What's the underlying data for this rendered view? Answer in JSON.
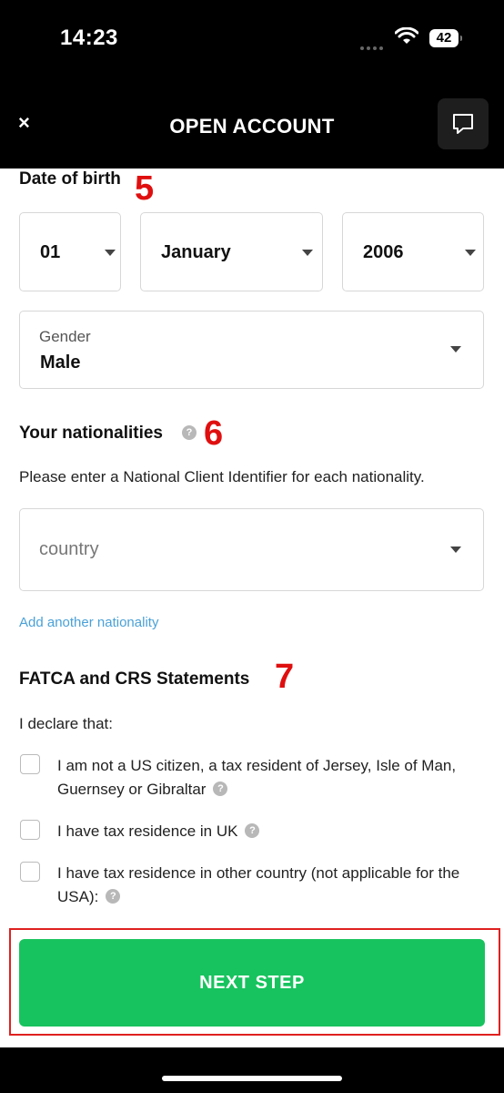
{
  "status_bar": {
    "time": "14:23",
    "battery": "42"
  },
  "header": {
    "close_label": "×",
    "title": "OPEN ACCOUNT"
  },
  "dob": {
    "title": "Date of birth",
    "step": "5",
    "day": "01",
    "month": "January",
    "year": "2006"
  },
  "gender": {
    "label": "Gender",
    "value": "Male"
  },
  "nationalities": {
    "title": "Your nationalities",
    "step": "6",
    "description": "Please enter a National Client Identifier for each nationality.",
    "country_placeholder": "country",
    "add_link": "Add another nationality"
  },
  "fatca": {
    "title": "FATCA and CRS Statements",
    "step": "7",
    "intro": "I declare that:",
    "items": [
      {
        "label": "I am not a US citizen, a tax resident of Jersey, Isle of Man, Guernsey or Gibraltar",
        "checked": false
      },
      {
        "label": "I have tax residence in UK",
        "checked": false
      },
      {
        "label": "I have tax residence in other country (not applicable for the USA):",
        "checked": false
      }
    ]
  },
  "next_button": "NEXT STEP",
  "help_glyph": "?",
  "colors": {
    "accent_green": "#17c35e",
    "annotation_red": "#e02020",
    "link_blue": "#4aa1d8"
  }
}
